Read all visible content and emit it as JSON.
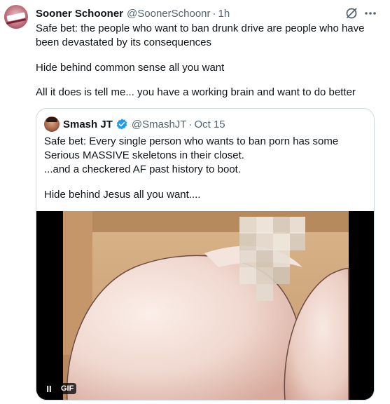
{
  "tweet": {
    "author": "Sooner Schooner",
    "handle": "@SoonerSchoonr",
    "separator": "·",
    "time": "1h",
    "paragraphs": [
      "Safe bet: the people who want to ban drunk drive are people who have been devastated by its consequences",
      "Hide behind common sense all you want",
      "All it does is tell me... you have a working brain and want to do better"
    ]
  },
  "quote": {
    "author": "Smash JT",
    "handle": "@SmashJT",
    "separator": "·",
    "date": "Oct 15",
    "lines": [
      "Safe bet: Every single person who wants to ban porn has some Serious MASSIVE skeletons in their closet.",
      "...and a checkered AF past history to boot.",
      "Hide behind Jesus all you want...."
    ],
    "media": {
      "type": "gif",
      "badge": "GIF",
      "pause_glyph": "II"
    }
  },
  "colors": {
    "text": "#0f1419",
    "muted": "#536471",
    "border": "#cfd9de",
    "verified": "#1d9bf0"
  },
  "icons": [
    "grok-icon",
    "more-icon",
    "verified-icon",
    "pause-icon"
  ]
}
